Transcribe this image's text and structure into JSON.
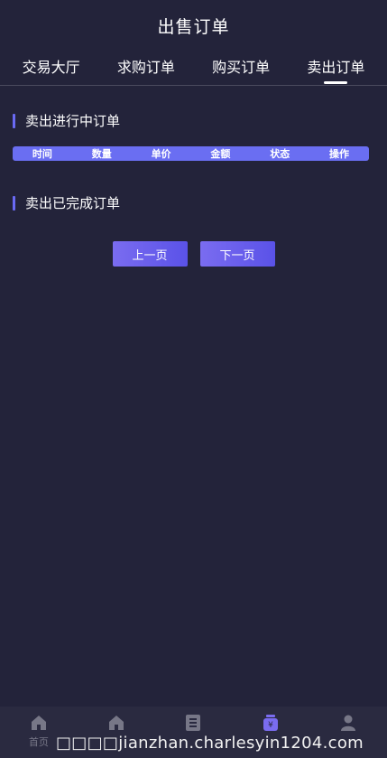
{
  "header": {
    "title": "出售订单"
  },
  "tabs": [
    {
      "label": "交易大厅"
    },
    {
      "label": "求购订单"
    },
    {
      "label": "购买订单"
    },
    {
      "label": "卖出订单"
    }
  ],
  "active_tab": 3,
  "ongoing": {
    "title": "卖出进行中订单",
    "columns": [
      "时间",
      "数量",
      "单价",
      "金额",
      "状态",
      "操作"
    ]
  },
  "completed": {
    "title": "卖出已完成订单"
  },
  "pager": {
    "prev": "上一页",
    "next": "下一页"
  },
  "bottom_nav": [
    {
      "label": "首页",
      "icon": "house-icon"
    },
    {
      "label": "",
      "icon": "store-icon"
    },
    {
      "label": "",
      "icon": "document-icon"
    },
    {
      "label": "",
      "icon": "wallet-icon"
    },
    {
      "label": "",
      "icon": "user-icon"
    }
  ],
  "active_nav": 3,
  "watermark": {
    "text": "□□□□jianzhan.charlesyin1204.com"
  },
  "colors": {
    "background": "#23233a",
    "accent": "#6a6ef2",
    "nav_bg": "#2a2a40"
  }
}
